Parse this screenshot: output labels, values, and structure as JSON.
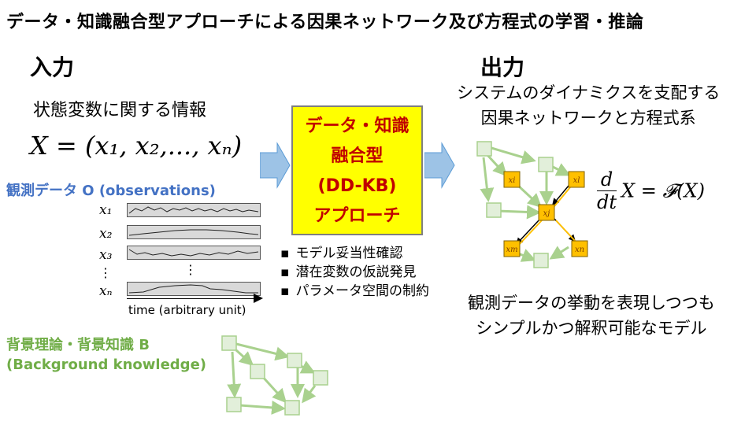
{
  "title": "データ・知識融合型アプローチによる因果ネットワーク及び方程式の学習・推論",
  "input": {
    "heading": "入力",
    "state_info": "状態変数に関する情報",
    "state_formula": "X = (x₁, x₂,..., xₙ)",
    "observations_label": "観測データ O (observations)",
    "variables": [
      "x₁",
      "x₂",
      "x₃",
      "xₙ"
    ],
    "vertical_ellipsis": "⋮",
    "time_axis_label": "time (arbitrary unit)",
    "background_label_line1": "背景理論・背景知識 B",
    "background_label_line2": "(Background knowledge)",
    "colors": {
      "observations": "#4472c4",
      "background": "#70ad47"
    }
  },
  "approach": {
    "lines": [
      "データ・知識",
      "融合型",
      "(DD-KB)",
      "アプローチ"
    ],
    "bullets": [
      "モデル妥当性確認",
      "潜在変数の仮説発見",
      "パラメータ空間の制約"
    ],
    "colors": {
      "fill": "#ffff00",
      "text": "#c00000"
    }
  },
  "output": {
    "heading": "出力",
    "description_line1": "システムのダイナミクスを支配する",
    "description_line2": "因果ネットワークと方程式系",
    "equation_frac_num": "d",
    "equation_frac_den": "dt",
    "equation_rest": "X  = 𝓕(X)",
    "node_labels": {
      "xi": "xi",
      "xl": "xl",
      "xj": "xj",
      "xm": "xm",
      "xn": "xn"
    },
    "summary_line1": "観測データの挙動を表現しつつも",
    "summary_line2": "シンプルかつ解釈可能なモデル",
    "colors": {
      "node_green": "#e2efda",
      "node_orange": "#ffc000",
      "edge_green": "#a9d18e",
      "edge_orange": "#ffc000"
    }
  }
}
